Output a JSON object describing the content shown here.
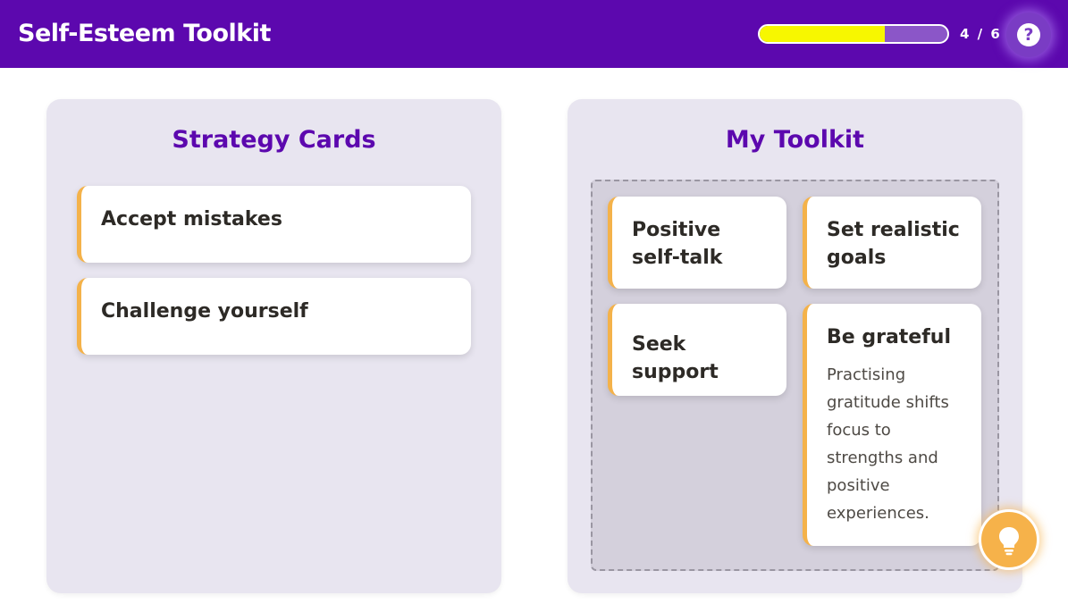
{
  "header": {
    "title": "Self-Esteem Toolkit",
    "progress_current": 4,
    "progress_total": 6,
    "progress_text": "4 / 6",
    "help_icon": "question-mark-icon"
  },
  "strategy_panel": {
    "title": "Strategy Cards",
    "cards": [
      {
        "label": "Accept mistakes"
      },
      {
        "label": "Challenge yourself"
      }
    ]
  },
  "toolkit_panel": {
    "title": "My Toolkit",
    "cards": [
      {
        "label": "Positive self-talk"
      },
      {
        "label": "Set realistic goals"
      },
      {
        "label": "Seek support"
      },
      {
        "label": "Be grateful",
        "description": "Practising gratitude shifts focus to strengths and positive experiences."
      }
    ]
  },
  "hint_button": {
    "icon": "lightbulb-icon"
  },
  "colors": {
    "brand_purple": "#5c08ae",
    "progress_fill": "#f7f700",
    "card_accent": "#f4b24a",
    "panel_bg": "#e8e5f0"
  }
}
